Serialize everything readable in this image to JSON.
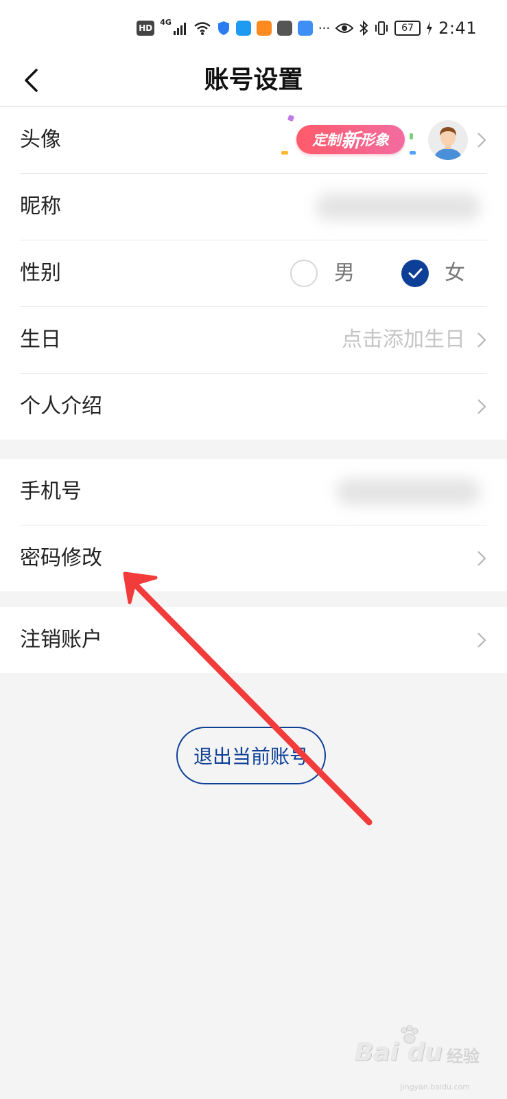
{
  "status_bar": {
    "hd": "HD",
    "net": "4G",
    "battery": "67",
    "time": "2:41",
    "more": "···"
  },
  "header": {
    "title": "账号设置"
  },
  "profile_group": {
    "avatar": {
      "label": "头像",
      "promo_small": "定制",
      "promo_big": "新",
      "promo_tail": "形象"
    },
    "nickname": {
      "label": "昵称"
    },
    "gender": {
      "label": "性别",
      "male": "男",
      "female": "女",
      "selected": "女"
    },
    "birthday": {
      "label": "生日",
      "hint": "点击添加生日"
    },
    "intro": {
      "label": "个人介绍"
    }
  },
  "security_group": {
    "phone": {
      "label": "手机号"
    },
    "password": {
      "label": "密码修改"
    }
  },
  "cancel_group": {
    "cancel_account": {
      "label": "注销账户"
    }
  },
  "logout_button": "退出当前账号",
  "watermark": {
    "brand": "Bai du",
    "cn": "经验",
    "url": "jingyan.baidu.com"
  },
  "colors": {
    "accent": "#0e3f97",
    "arrow": "#f23b3b",
    "promo": "#ff5a6a"
  }
}
